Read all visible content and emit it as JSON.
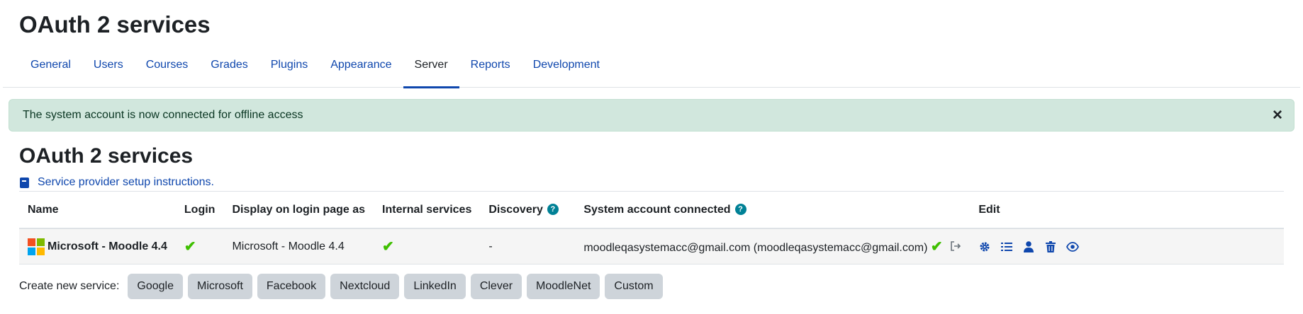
{
  "page": {
    "title": "OAuth 2 services"
  },
  "nav": {
    "tabs": [
      {
        "label": "General"
      },
      {
        "label": "Users"
      },
      {
        "label": "Courses"
      },
      {
        "label": "Grades"
      },
      {
        "label": "Plugins"
      },
      {
        "label": "Appearance"
      },
      {
        "label": "Server",
        "active": true
      },
      {
        "label": "Reports"
      },
      {
        "label": "Development"
      }
    ]
  },
  "alert": {
    "message": "The system account is now connected for offline access",
    "close_icon": "×",
    "color": "#d1e7dd"
  },
  "section": {
    "title": "OAuth 2 services",
    "instructions_link": "Service provider setup instructions."
  },
  "table": {
    "headers": {
      "name": "Name",
      "login": "Login",
      "display": "Display on login page as",
      "internal": "Internal services",
      "discovery": "Discovery",
      "system_account": "System account connected",
      "edit": "Edit"
    },
    "help_icon": "?",
    "rows": [
      {
        "name": "Microsoft - Moodle 4.4",
        "login_icon": "check-icon",
        "display": "Microsoft - Moodle 4.4",
        "internal_icon": "check-icon",
        "discovery": "-",
        "system_account": "moodleqasystemacc@gmail.com (moodleqasystemacc@gmail.com)",
        "check_glyph": "✔"
      }
    ]
  },
  "create": {
    "label": "Create new service:",
    "buttons": [
      "Google",
      "Microsoft",
      "Facebook",
      "Nextcloud",
      "LinkedIn",
      "Clever",
      "MoodleNet",
      "Custom"
    ]
  },
  "colors": {
    "link": "#0f47ad",
    "check": "#3fbf00",
    "help": "#008196",
    "button_bg": "#ced4da"
  }
}
